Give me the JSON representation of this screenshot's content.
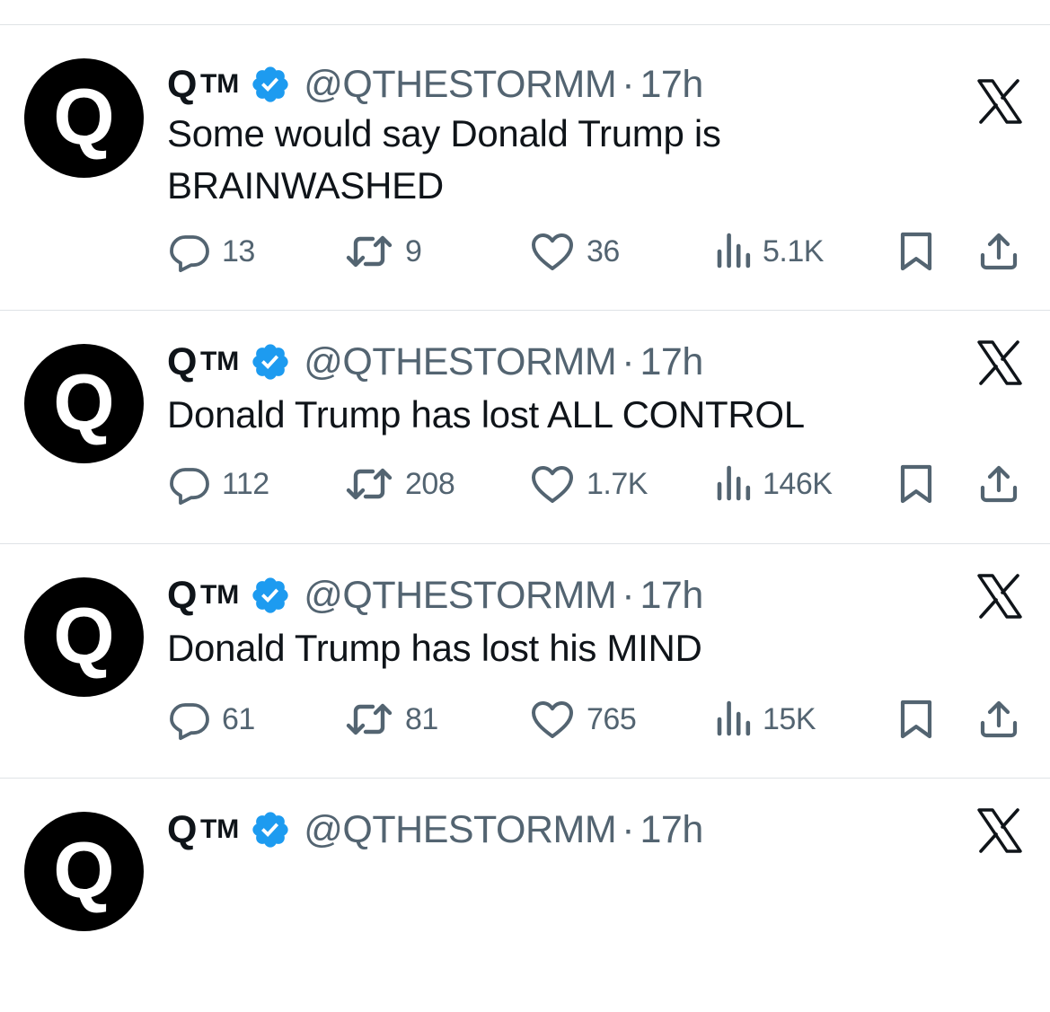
{
  "colors": {
    "text": "#0f1419",
    "secondary": "#536471",
    "verified_blue": "#1d9bf0",
    "divider": "#dfe3e6",
    "avatar_bg": "#000000"
  },
  "tweets": [
    {
      "name": "Q",
      "tm": "TM",
      "handle": "@QTHESTORMM",
      "separator": "·",
      "time": "17h",
      "text": "Some would say Donald Trump is BRAINWASHED",
      "replies": "13",
      "reposts": "9",
      "likes": "36",
      "views": "5.1K"
    },
    {
      "name": "Q",
      "tm": "TM",
      "handle": "@QTHESTORMM",
      "separator": "·",
      "time": "17h",
      "text": "Donald Trump has lost ALL CONTROL",
      "replies": "112",
      "reposts": "208",
      "likes": "1.7K",
      "views": "146K"
    },
    {
      "name": "Q",
      "tm": "TM",
      "handle": "@QTHESTORMM",
      "separator": "·",
      "time": "17h",
      "text": "Donald Trump has lost his MIND",
      "replies": "61",
      "reposts": "81",
      "likes": "765",
      "views": "15K"
    },
    {
      "name": "Q",
      "tm": "TM",
      "handle": "@QTHESTORMM",
      "separator": "·",
      "time": "17h",
      "text": "",
      "replies": "",
      "reposts": "",
      "likes": "",
      "views": ""
    }
  ],
  "icons": {
    "reply": "reply-bubble-icon",
    "repost": "repost-arrows-icon",
    "like": "heart-icon",
    "views": "views-bar-chart-icon",
    "bookmark": "bookmark-icon",
    "share": "share-upload-icon",
    "verified": "verified-badge-icon",
    "grok": "x-grok-icon"
  }
}
